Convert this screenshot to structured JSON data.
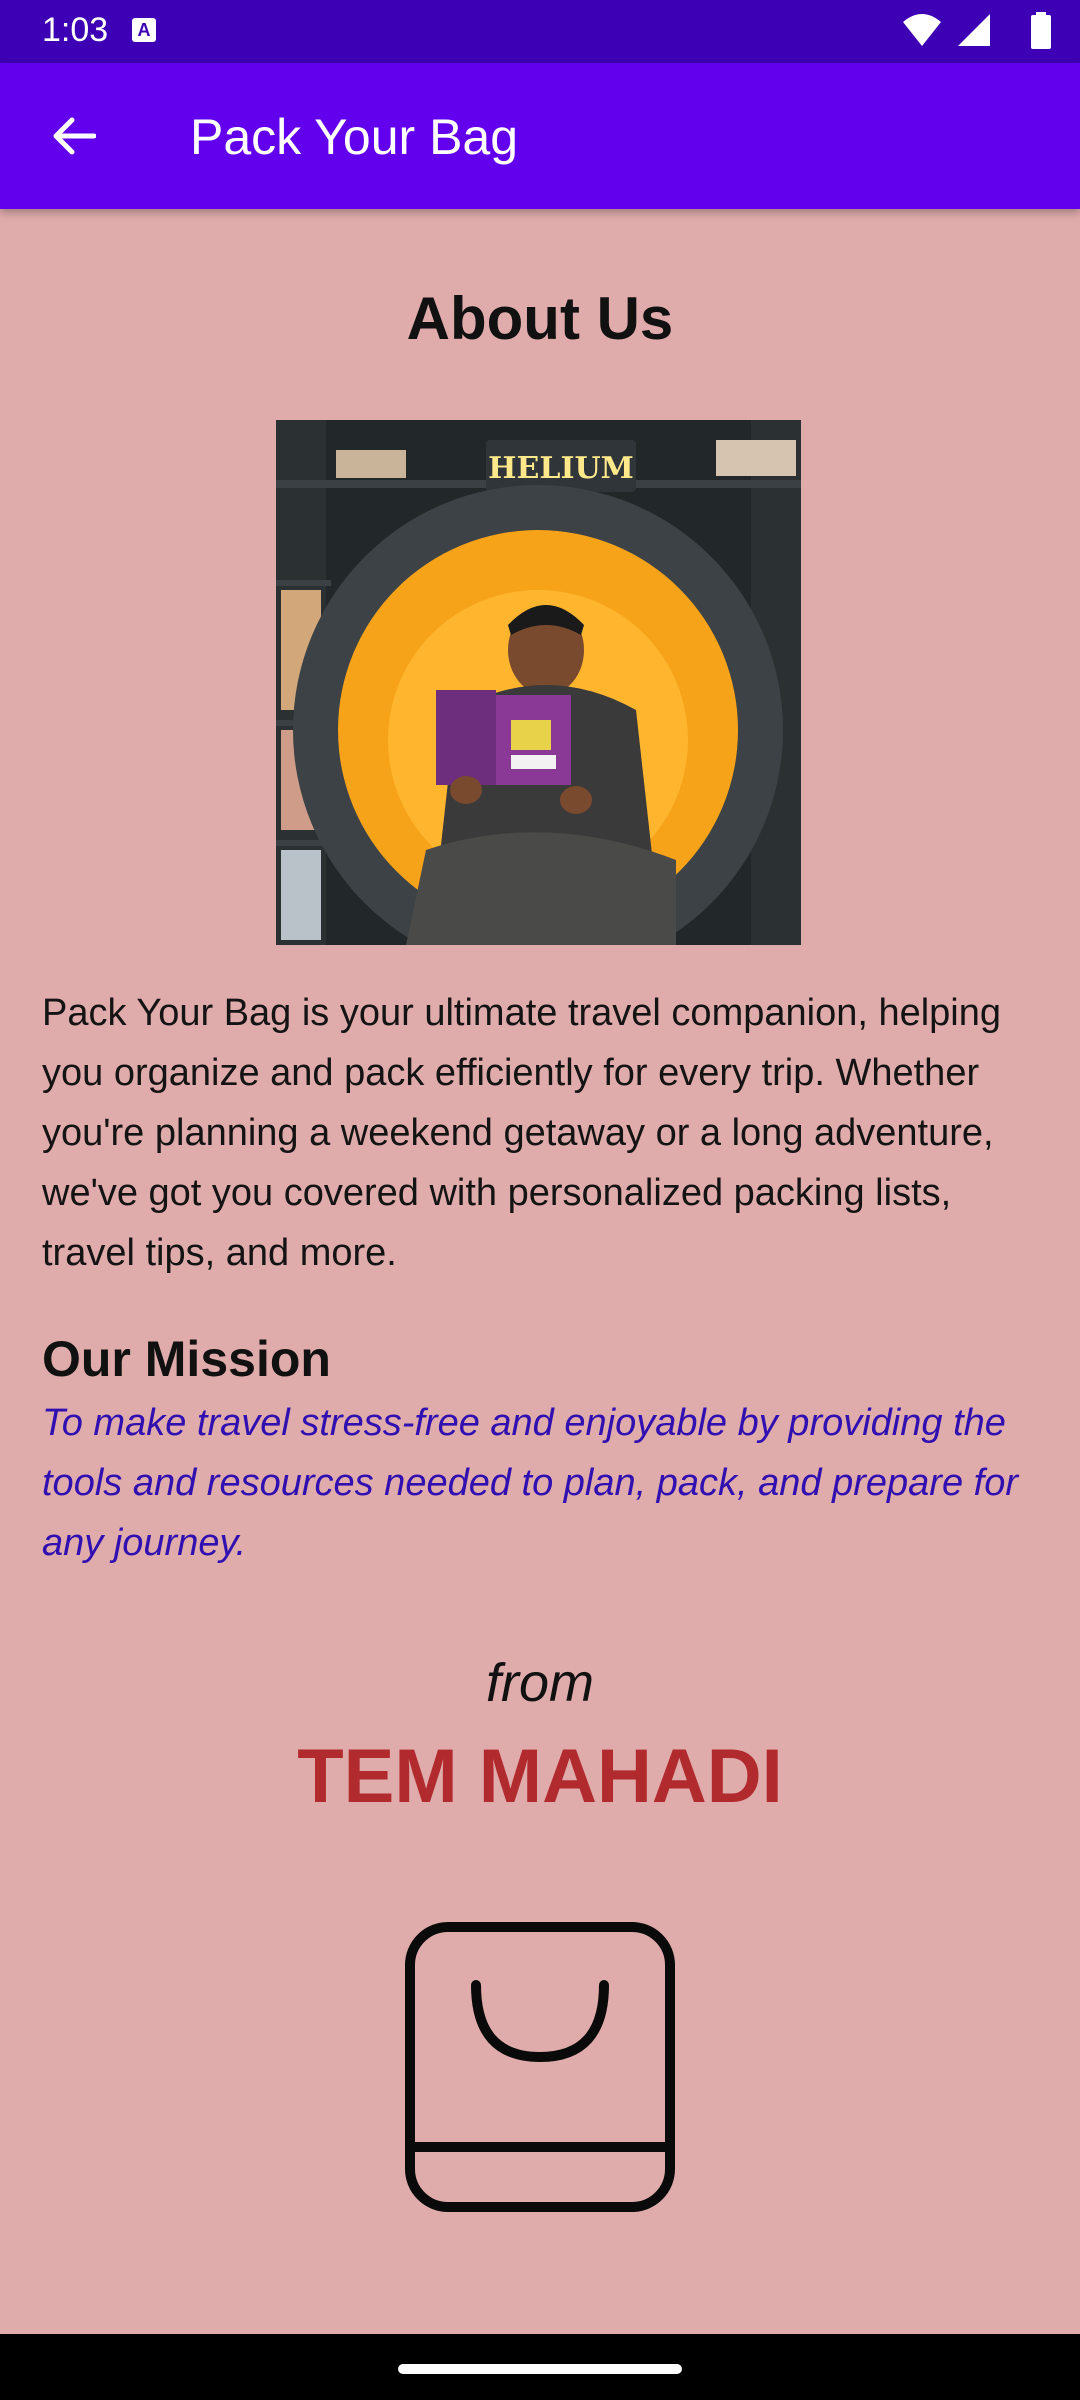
{
  "status_bar": {
    "time": "1:03",
    "notification_letter": "A",
    "icons": [
      "wifi-icon",
      "signal-icon",
      "battery-icon"
    ]
  },
  "app_bar": {
    "title": "Pack Your Bag",
    "back_icon": "arrow-back-icon",
    "color": "#6200ee"
  },
  "about": {
    "heading": "About Us",
    "photo_sign": "HELIUM",
    "description": "Pack Your Bag is your ultimate travel companion, helping you organize and pack efficiently for every trip. Whether you're planning a weekend getaway or a long adventure, we've got you covered with personalized packing lists, travel tips, and more."
  },
  "mission": {
    "heading": "Our Mission",
    "text": "To make travel stress-free and enjoyable by providing the tools and resources needed to plan, pack, and prepare for any journey."
  },
  "credit": {
    "from_label": "from",
    "author": "TEM MAHADI",
    "author_color": "#b12a2e"
  },
  "logo_icon": "shopping-bag-icon",
  "background_color": "#e0abab"
}
